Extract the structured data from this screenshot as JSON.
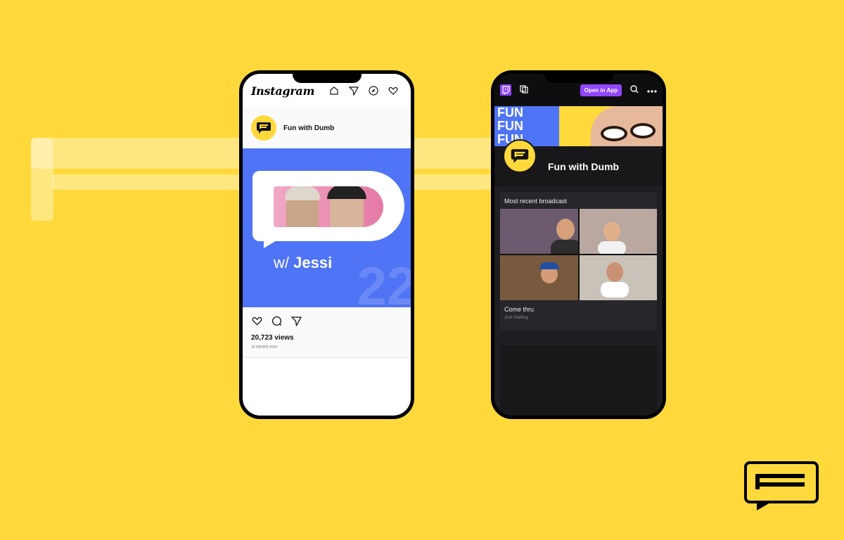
{
  "instagram": {
    "logo": "Instagram",
    "account": "Fun with Dumb",
    "image": {
      "guest_prefix": "w/",
      "guest_name": "Jessi",
      "episode": "22"
    },
    "views": "20,723 views",
    "posted": "10 HOURS AGO"
  },
  "twitch": {
    "open_in_app": "Open in App",
    "banner_text": "FUN",
    "channel": "Fun with Dumb",
    "section_title": "Most recent broadcast",
    "broadcast_title": "Come thru",
    "broadcast_category": "Just chatting"
  },
  "colors": {
    "background": "#FFD93B",
    "instagram_blue": "#4F74F5",
    "twitch_purple": "#9146FF"
  }
}
